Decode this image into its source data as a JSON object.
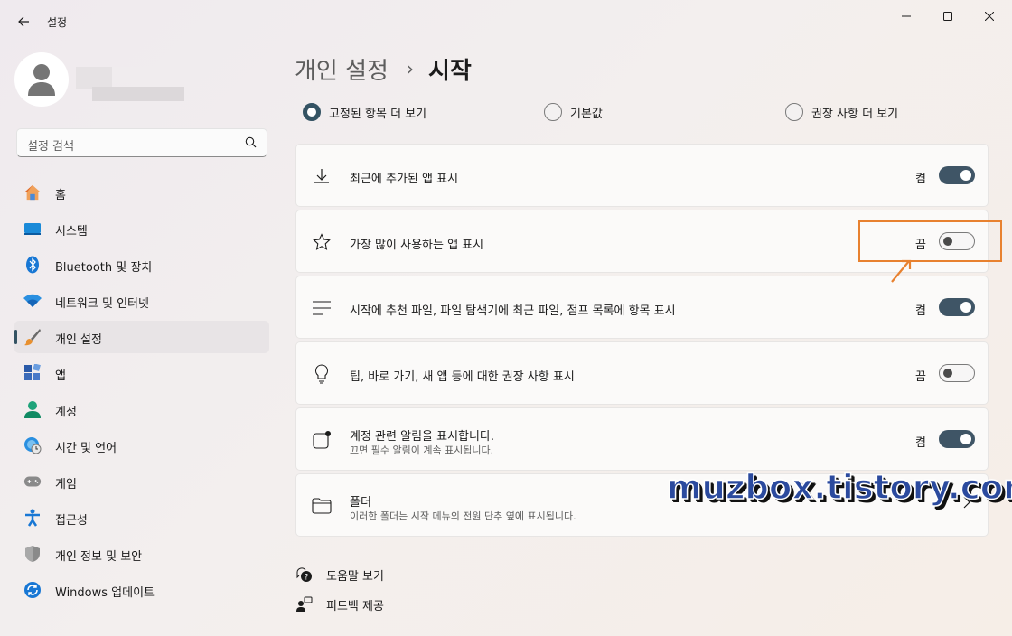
{
  "window": {
    "title": "설정"
  },
  "sidebar": {
    "search_placeholder": "설정 검색",
    "items": [
      {
        "label": "홈",
        "icon": "home-icon"
      },
      {
        "label": "시스템",
        "icon": "system-icon"
      },
      {
        "label": "Bluetooth 및 장치",
        "icon": "bluetooth-icon"
      },
      {
        "label": "네트워크 및 인터넷",
        "icon": "wifi-icon"
      },
      {
        "label": "개인 설정",
        "icon": "brush-icon",
        "active": true
      },
      {
        "label": "앱",
        "icon": "apps-icon"
      },
      {
        "label": "계정",
        "icon": "account-icon"
      },
      {
        "label": "시간 및 언어",
        "icon": "time-language-icon"
      },
      {
        "label": "게임",
        "icon": "gamepad-icon"
      },
      {
        "label": "접근성",
        "icon": "accessibility-icon"
      },
      {
        "label": "개인 정보 및 보안",
        "icon": "shield-icon"
      },
      {
        "label": "Windows 업데이트",
        "icon": "update-icon"
      }
    ]
  },
  "breadcrumb": {
    "parent": "개인 설정",
    "separator": "›",
    "current": "시작"
  },
  "layout_options": [
    {
      "label": "고정된 항목 더 보기",
      "checked": true
    },
    {
      "label": "기본값",
      "checked": false
    },
    {
      "label": "권장 사항 더 보기",
      "checked": false
    }
  ],
  "settings": [
    {
      "title": "최근에 추가된 앱 표시",
      "state": "켬",
      "on": true,
      "icon": "download-icon"
    },
    {
      "title": "가장 많이 사용하는 앱 표시",
      "state": "끔",
      "on": false,
      "icon": "star-icon"
    },
    {
      "title": "시작에 추천 파일, 파일 탐색기에 최근 파일, 점프 목록에 항목 표시",
      "state": "켬",
      "on": true,
      "icon": "list-icon"
    },
    {
      "title": "팁, 바로 가기, 새 앱 등에 대한 권장 사항 표시",
      "state": "끔",
      "on": false,
      "icon": "lightbulb-icon"
    },
    {
      "title": "계정 관련 알림을 표시합니다.",
      "subtitle": "끄면 필수 알림이 계속 표시됩니다.",
      "state": "켬",
      "on": true,
      "icon": "notification-icon"
    },
    {
      "title": "폴더",
      "subtitle": "이러한 폴더는 시작 메뉴의 전원 단추 옆에 표시됩니다.",
      "icon": "folder-icon"
    }
  ],
  "footer": {
    "help": "도움말 보기",
    "feedback": "피드백 제공"
  },
  "watermark": "muzbox.tistory.com",
  "colors": {
    "accent": "#345363",
    "highlight": "#e8812f"
  }
}
